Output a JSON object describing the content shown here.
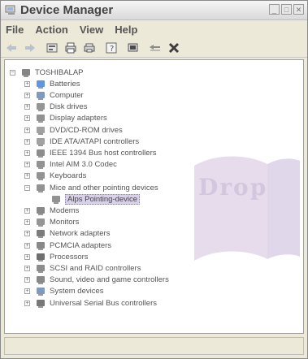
{
  "window": {
    "title": "Device Manager"
  },
  "menu": [
    {
      "label": "File"
    },
    {
      "label": "Action"
    },
    {
      "label": "View"
    },
    {
      "label": "Help"
    }
  ],
  "toolbar": {
    "buttons": [
      {
        "name": "back-icon"
      },
      {
        "name": "forward-icon"
      },
      {
        "name": "properties-icon"
      },
      {
        "name": "print-icon"
      },
      {
        "name": "printer-icon"
      },
      {
        "name": "help-icon"
      },
      {
        "name": "scan-hardware-icon"
      },
      {
        "name": "update-driver-icon"
      },
      {
        "name": "uninstall-icon"
      }
    ]
  },
  "watermark": {
    "text": "Drop"
  },
  "tree": {
    "root": "TOSHIBALAP",
    "items": [
      {
        "label": "Batteries",
        "icon": "battery-icon",
        "color": "#3a7bd5"
      },
      {
        "label": "Computer",
        "icon": "computer-icon",
        "color": "#5f7fb5"
      },
      {
        "label": "Disk drives",
        "icon": "disk-icon",
        "color": "#7a7a7a"
      },
      {
        "label": "Display adapters",
        "icon": "display-adapter-icon",
        "color": "#777777"
      },
      {
        "label": "DVD/CD-ROM drives",
        "icon": "dvd-icon",
        "color": "#888888"
      },
      {
        "label": "IDE ATA/ATAPI controllers",
        "icon": "ide-icon",
        "color": "#8a8a8a"
      },
      {
        "label": "IEEE 1394 Bus host controllers",
        "icon": "ieee-icon",
        "color": "#6f6f6f"
      },
      {
        "label": "Intel AIM 3.0 Codec",
        "icon": "codec-icon",
        "color": "#777777"
      },
      {
        "label": "Keyboards",
        "icon": "keyboard-icon",
        "color": "#777777"
      },
      {
        "label": "Mice and other pointing devices",
        "icon": "mouse-icon",
        "color": "#777777"
      },
      {
        "label": "Alps Pointing-device",
        "icon": "mouse-icon",
        "color": "#777777",
        "selected": true,
        "child": true
      },
      {
        "label": "Modems",
        "icon": "modem-icon",
        "color": "#6a6a6a"
      },
      {
        "label": "Monitors",
        "icon": "monitor-icon",
        "color": "#7a7a7a"
      },
      {
        "label": "Network adapters",
        "icon": "network-icon",
        "color": "#5a5a5a"
      },
      {
        "label": "PCMCIA adapters",
        "icon": "pcmcia-icon",
        "color": "#6a6a6a"
      },
      {
        "label": "Processors",
        "icon": "processor-icon",
        "color": "#4a4a4a"
      },
      {
        "label": "SCSI and RAID controllers",
        "icon": "scsi-icon",
        "color": "#6f6f6f"
      },
      {
        "label": "Sound, video and game controllers",
        "icon": "sound-icon",
        "color": "#6a6a6a"
      },
      {
        "label": "System devices",
        "icon": "system-icon",
        "color": "#5f7fb5"
      },
      {
        "label": "Universal Serial Bus controllers",
        "icon": "usb-icon",
        "color": "#555555"
      }
    ]
  }
}
